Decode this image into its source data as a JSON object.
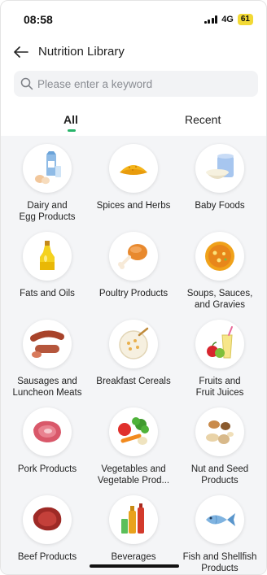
{
  "status_bar": {
    "time": "08:58",
    "network": "4G",
    "battery": "61"
  },
  "header": {
    "title": "Nutrition Library",
    "back_icon": "arrow-left-icon"
  },
  "search": {
    "placeholder": "Please enter a keyword",
    "value": "",
    "icon": "search-icon"
  },
  "tabs": [
    {
      "label": "All",
      "active": true
    },
    {
      "label": "Recent",
      "active": false
    }
  ],
  "accent_color": "#28b46a",
  "categories": [
    {
      "label": "Dairy and\nEgg Products",
      "icon": "milk-eggs-icon"
    },
    {
      "label": "Spices and Herbs",
      "icon": "spices-icon"
    },
    {
      "label": "Baby Foods",
      "icon": "baby-food-icon"
    },
    {
      "label": "Fats and Oils",
      "icon": "oil-bottle-icon"
    },
    {
      "label": "Poultry Products",
      "icon": "drumstick-icon"
    },
    {
      "label": "Soups, Sauces,\nand Gravies",
      "icon": "soup-bowl-icon"
    },
    {
      "label": "Sausages and\nLuncheon Meats",
      "icon": "sausage-icon"
    },
    {
      "label": "Breakfast Cereals",
      "icon": "cereal-bowl-icon"
    },
    {
      "label": "Fruits and\nFruit Juices",
      "icon": "fruit-juice-icon"
    },
    {
      "label": "Pork Products",
      "icon": "pork-icon"
    },
    {
      "label": "Vegetables and\nVegetable Prod...",
      "icon": "vegetables-icon"
    },
    {
      "label": "Nut and Seed\nProducts",
      "icon": "nuts-icon"
    },
    {
      "label": "Beef Products",
      "icon": "beef-icon"
    },
    {
      "label": "Beverages",
      "icon": "beverages-icon"
    },
    {
      "label": "Fish and Shellfish\nProducts",
      "icon": "fish-icon"
    }
  ]
}
